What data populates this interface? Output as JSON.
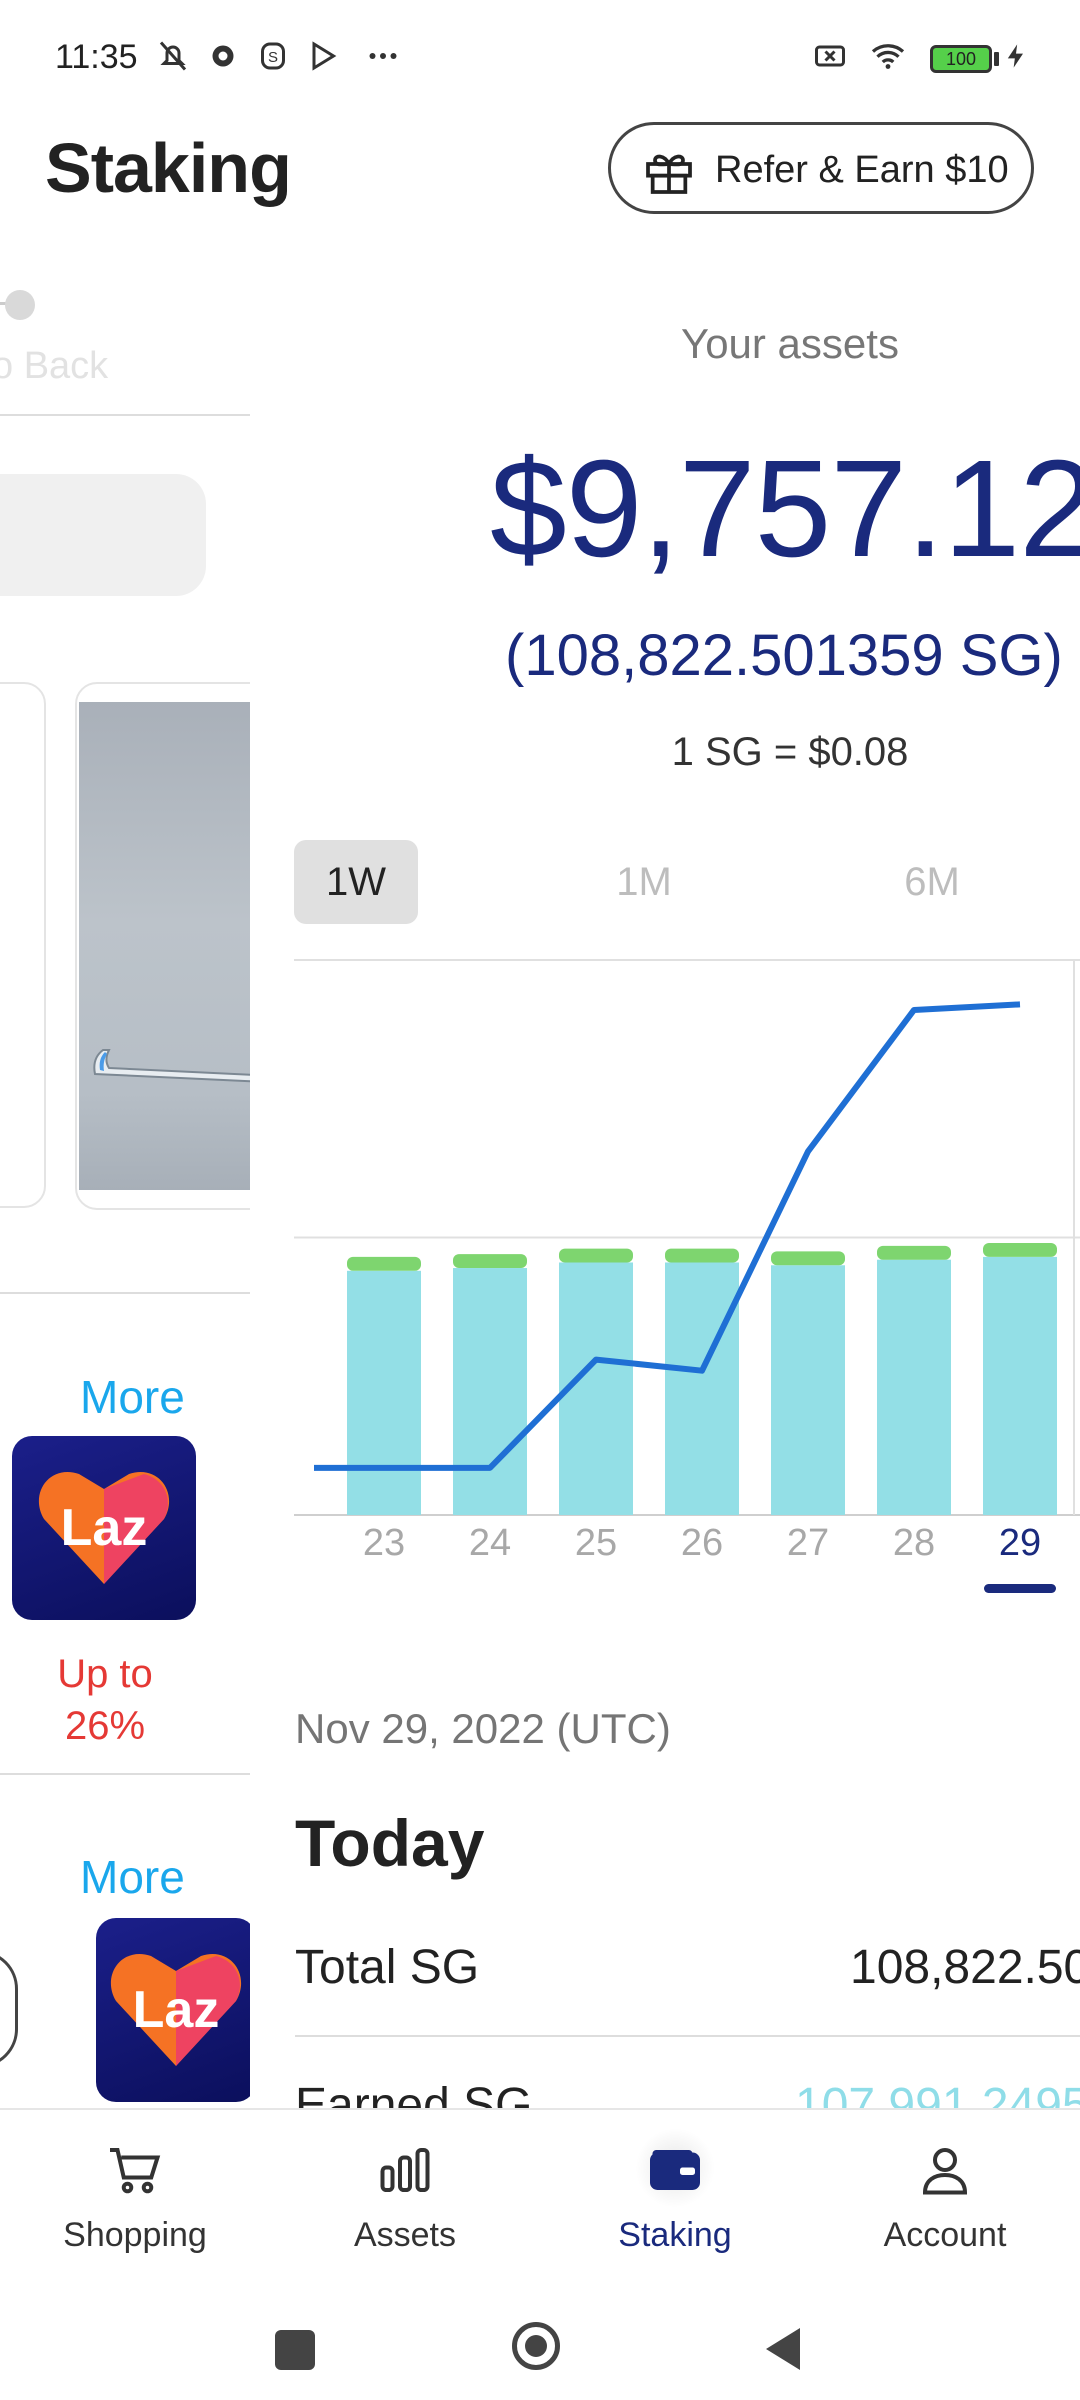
{
  "status_bar": {
    "time": "11:35",
    "battery": "100",
    "icons": [
      "bell-off-icon",
      "gear-icon",
      "s-shield-icon",
      "play-store-icon",
      "more-dots-icon",
      "sim-x-icon",
      "wifi-icon",
      "battery-icon",
      "charging-icon"
    ]
  },
  "header": {
    "title": "Staking",
    "refer_button": "Refer & Earn $10"
  },
  "left_panel": {
    "back_text": "o Back",
    "more_1": "More",
    "more_2": "More",
    "laz_text_1": "Laz",
    "laz_text_2": "Laz",
    "promo_line1": "Up to",
    "promo_line2": "26%"
  },
  "assets": {
    "label": "Your assets",
    "usd_value": "$9,757.12",
    "sg_value": "(108,822.501359 SG)",
    "rate": "1 SG = $0.08"
  },
  "range_tabs": [
    {
      "label": "1W",
      "active": true
    },
    {
      "label": "1M",
      "active": false
    },
    {
      "label": "6M",
      "active": false
    }
  ],
  "chart_data": {
    "type": "bar",
    "categories": [
      "23",
      "24",
      "25",
      "26",
      "27",
      "28",
      "29"
    ],
    "selected_category": "29",
    "series": [
      {
        "name": "",
        "type": "bar",
        "color": "#93dfe6",
        "values": [
          88,
          89,
          91,
          91,
          90,
          92,
          93
        ]
      },
      {
        "name": "",
        "type": "bar",
        "color": "#7ed56f",
        "values": [
          5,
          5,
          5,
          5,
          5,
          5,
          5
        ]
      },
      {
        "name": "",
        "type": "line",
        "color": "#1f6fd4",
        "values": [
          17,
          17,
          56,
          52,
          131,
          182,
          184
        ]
      }
    ],
    "ylim": [
      0,
      200
    ],
    "grid": true
  },
  "details": {
    "date": "Nov 29, 2022 (UTC)",
    "heading": "Today",
    "rows": [
      {
        "label": "Total SG",
        "value": "108,822.50",
        "color": "#222222"
      },
      {
        "label": "Earned SG",
        "value": "107,991.2495",
        "color": "#8fdde8"
      }
    ]
  },
  "bottom_nav": [
    {
      "label": "Shopping",
      "icon": "cart-icon",
      "active": false
    },
    {
      "label": "Assets",
      "icon": "bar-chart-icon",
      "active": false
    },
    {
      "label": "Staking",
      "icon": "wallet-icon",
      "active": true
    },
    {
      "label": "Account",
      "icon": "person-icon",
      "active": false
    }
  ],
  "colors": {
    "primary": "#1a2a7d",
    "link": "#1aa7ec",
    "promo": "#e53935"
  }
}
